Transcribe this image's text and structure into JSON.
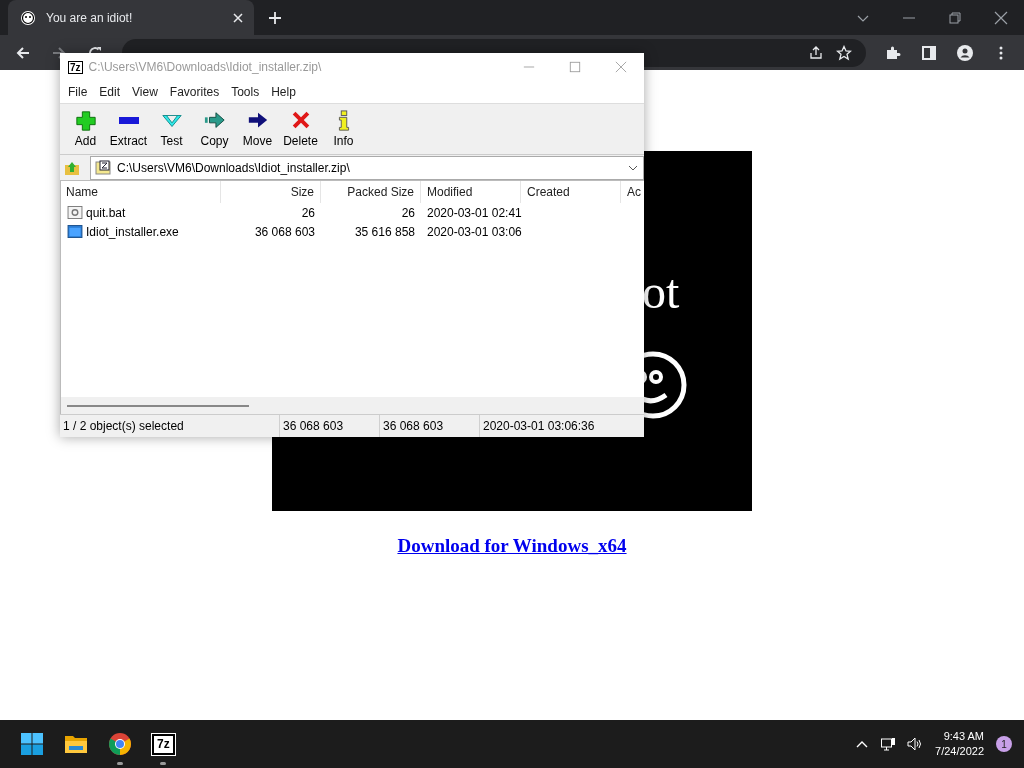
{
  "browser": {
    "tab": {
      "title": "You are an idiot!"
    }
  },
  "page": {
    "heading_fragment": "ot",
    "link": "Download for Windows_x64"
  },
  "archive_window": {
    "icon_label": "7z",
    "title": "C:\\Users\\VM6\\Downloads\\Idiot_installer.zip\\",
    "menu": [
      "File",
      "Edit",
      "View",
      "Favorites",
      "Tools",
      "Help"
    ],
    "toolbar": [
      {
        "kind": "add",
        "label": "Add"
      },
      {
        "kind": "extract",
        "label": "Extract"
      },
      {
        "kind": "test",
        "label": "Test"
      },
      {
        "kind": "copy",
        "label": "Copy"
      },
      {
        "kind": "move",
        "label": "Move"
      },
      {
        "kind": "delete",
        "label": "Delete"
      },
      {
        "kind": "info",
        "label": "Info"
      }
    ],
    "address": "C:\\Users\\VM6\\Downloads\\Idiot_installer.zip\\",
    "columns": [
      "Name",
      "Size",
      "Packed Size",
      "Modified",
      "Created",
      "Ac"
    ],
    "rows": [
      {
        "kind": "script",
        "name": "quit.bat",
        "size": "26",
        "packed_size": "26",
        "modified": "2020-03-01 02:41"
      },
      {
        "kind": "program",
        "name": "Idiot_installer.exe",
        "size": "36 068 603",
        "packed_size": "35 616 858",
        "modified": "2020-03-01 03:06"
      }
    ],
    "status_bar": [
      "1 / 2 object(s) selected",
      "36 068 603",
      "36 068 603",
      "2020-03-01 03:06:36"
    ]
  },
  "taskbar": {
    "apps": [
      {
        "kind": "start",
        "running": false
      },
      {
        "kind": "folder",
        "running": false
      },
      {
        "kind": "chrome",
        "running": true
      },
      {
        "kind": "sevenzip",
        "label": "7z",
        "running": true
      }
    ],
    "time": "9:43 AM",
    "date": "7/24/2022",
    "notification_count": "1"
  }
}
